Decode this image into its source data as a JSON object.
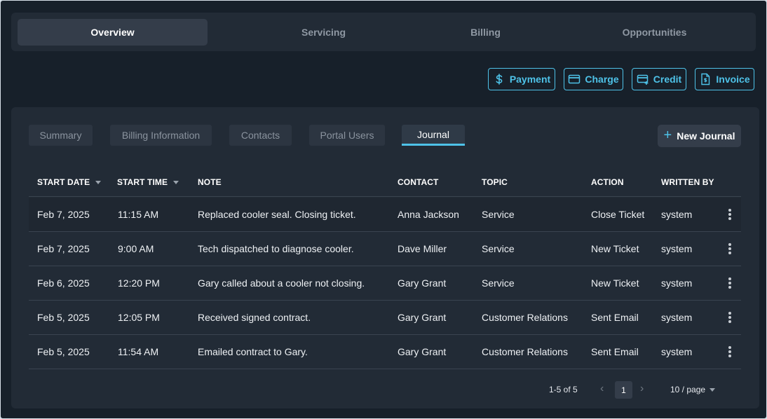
{
  "top_tabs": [
    {
      "label": "Overview",
      "active": true
    },
    {
      "label": "Servicing",
      "active": false
    },
    {
      "label": "Billing",
      "active": false
    },
    {
      "label": "Opportunities",
      "active": false
    }
  ],
  "actions": {
    "payment": "Payment",
    "charge": "Charge",
    "credit": "Credit",
    "invoice": "Invoice"
  },
  "sub_tabs": [
    {
      "label": "Summary",
      "active": false
    },
    {
      "label": "Billing Information",
      "active": false
    },
    {
      "label": "Contacts",
      "active": false
    },
    {
      "label": "Portal Users",
      "active": false
    },
    {
      "label": "Journal",
      "active": true
    }
  ],
  "new_journal_label": "New Journal",
  "table": {
    "columns": [
      "START DATE",
      "START TIME",
      "NOTE",
      "CONTACT",
      "TOPIC",
      "ACTION",
      "WRITTEN BY"
    ],
    "rows": [
      {
        "date": "Feb 7, 2025",
        "time": "11:15 AM",
        "note": "Replaced cooler seal. Closing ticket.",
        "contact": "Anna Jackson",
        "topic": "Service",
        "action": "Close Ticket",
        "written_by": "system"
      },
      {
        "date": "Feb 7, 2025",
        "time": "9:00 AM",
        "note": "Tech dispatched to diagnose cooler.",
        "contact": "Dave Miller",
        "topic": "Service",
        "action": "New Ticket",
        "written_by": "system"
      },
      {
        "date": "Feb 6, 2025",
        "time": "12:20 PM",
        "note": "Gary called about a cooler not closing.",
        "contact": "Gary Grant",
        "topic": "Service",
        "action": "New Ticket",
        "written_by": "system"
      },
      {
        "date": "Feb 5, 2025",
        "time": "12:05 PM",
        "note": "Received signed contract.",
        "contact": "Gary Grant",
        "topic": "Customer Relations",
        "action": "Sent Email",
        "written_by": "system"
      },
      {
        "date": "Feb 5, 2025",
        "time": "11:54 AM",
        "note": "Emailed contract to Gary.",
        "contact": "Gary Grant",
        "topic": "Customer Relations",
        "action": "Sent Email",
        "written_by": "system"
      }
    ]
  },
  "pagination": {
    "info": "1-5 of 5",
    "current_page": "1",
    "page_size": "10 / page",
    "prev_icon": "‹",
    "next_icon": "›"
  },
  "colors": {
    "accent": "#4ec2e8",
    "background": "#17202a",
    "panel": "#222b36"
  }
}
